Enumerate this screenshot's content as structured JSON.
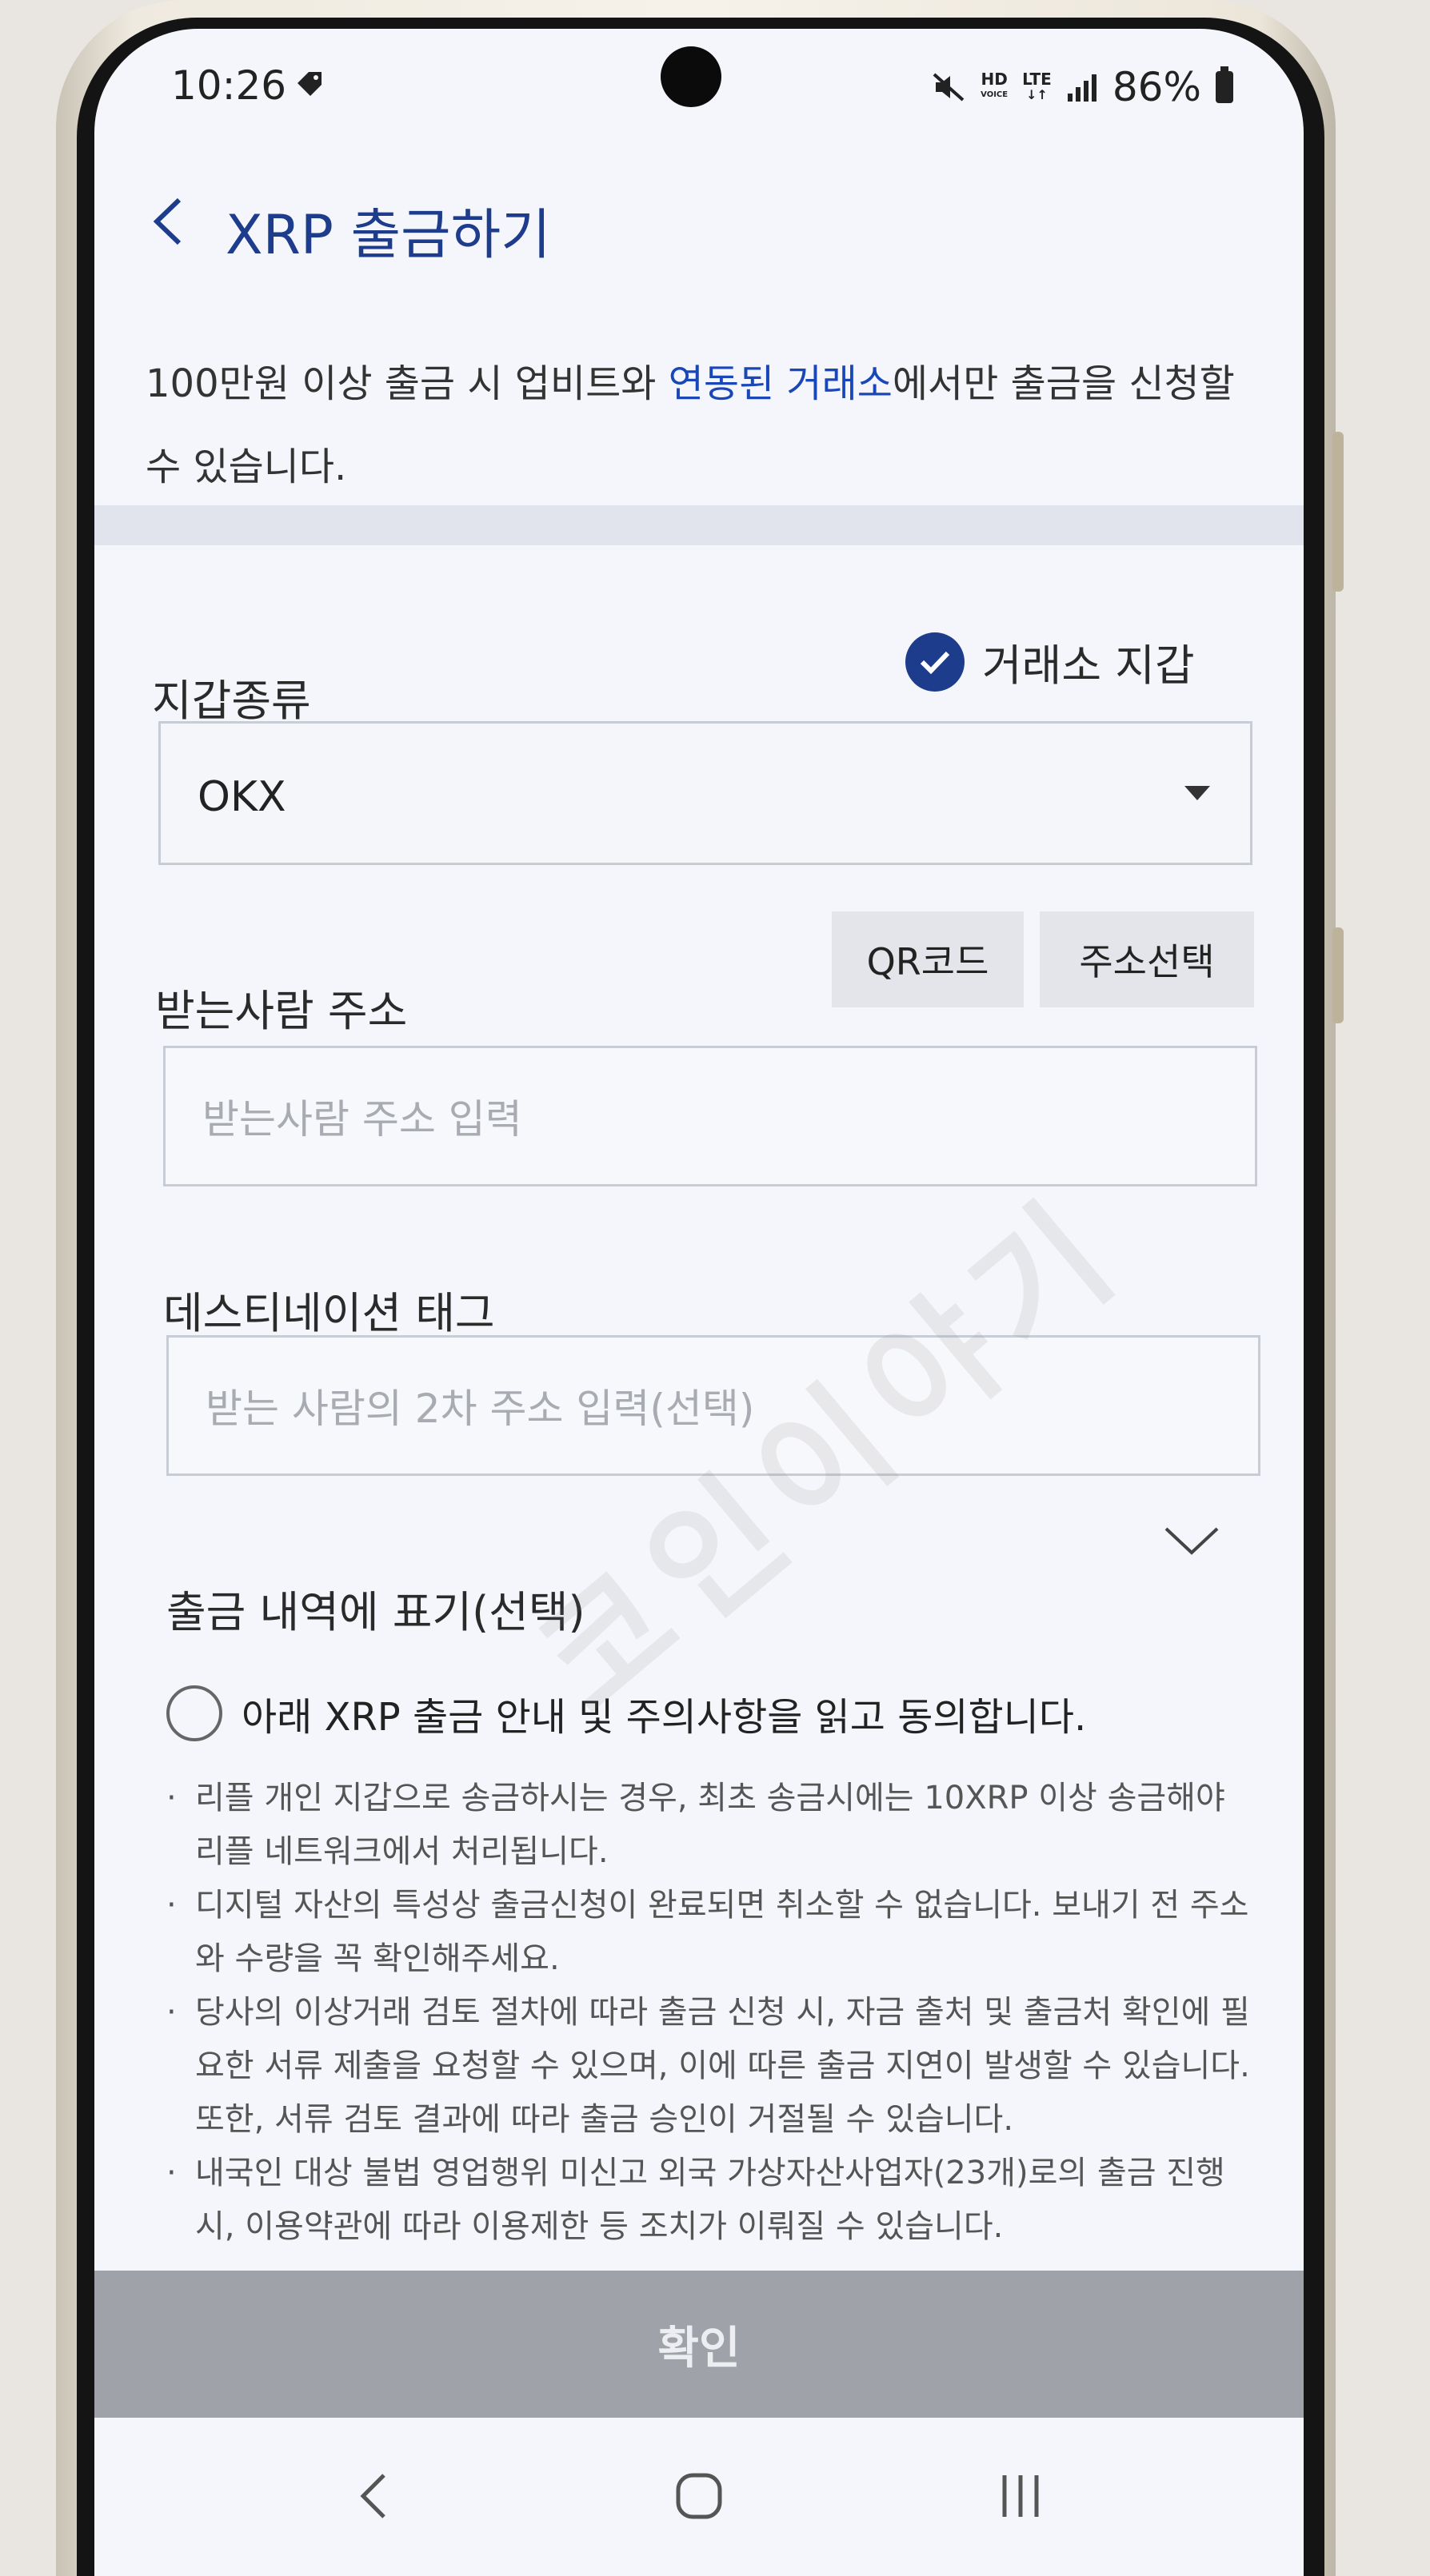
{
  "status_bar": {
    "time": "10:26",
    "hd": "HD",
    "hd_sub": "VOICE",
    "lte": "LTE",
    "battery": "86%"
  },
  "header": {
    "title": "XRP 출금하기"
  },
  "notice": {
    "part1": "100만원 이상 출금 시 업비트와 ",
    "link": "연동된 거래소",
    "part2": "에서만 출금을 신청할 수 있습니다."
  },
  "wallet": {
    "label": "지갑종류",
    "exchange_checkbox_label": "거래소 지갑",
    "exchange_checked": true,
    "selected": "OKX"
  },
  "recipient": {
    "label": "받는사람 주소",
    "qr_button": "QR코드",
    "address_book_button": "주소선택",
    "placeholder": "받는사람 주소 입력"
  },
  "destination_tag": {
    "label": "데스티네이션 태그",
    "placeholder": "받는 사람의 2차 주소 입력(선택)"
  },
  "memo": {
    "label": "출금 내역에 표기(선택)"
  },
  "agreement": {
    "label": "아래 XRP 출금 안내 및 주의사항을 읽고 동의합니다.",
    "checked": false,
    "notes": [
      "리플 개인 지갑으로 송금하시는 경우, 최초 송금시에는 10XRP 이상 송금해야 리플 네트워크에서 처리됩니다.",
      "디지털 자산의 특성상 출금신청이 완료되면 취소할 수 없습니다. 보내기 전 주소와 수량을 꼭 확인해주세요.",
      "당사의 이상거래 검토 절차에 따라 출금 신청 시, 자금 출처 및 출금처 확인에 필요한 서류 제출을 요청할 수 있으며, 이에 따른 출금 지연이 발생할 수 있습니다. 또한, 서류 검토 결과에 따라 출금 승인이 거절될 수 있습니다.",
      "내국인 대상 불법 영업행위 미신고 외국 가상자산사업자(23개)로의 출금 진행 시, 이용약관에 따라 이용제한 등 조치가 이뤄질 수 있습니다."
    ]
  },
  "confirm_button": "확인",
  "watermark": "코인이야기",
  "colors": {
    "accent": "#1d3c8c",
    "link": "#1a47b8",
    "disabled_button": "#9fa2a8"
  }
}
